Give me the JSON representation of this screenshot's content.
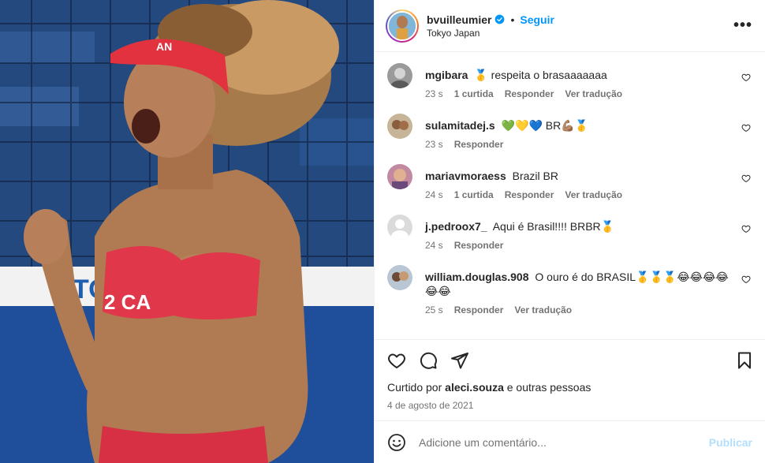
{
  "post": {
    "photo_alt": "Beach volleyball player celebrating",
    "jersey_text": "2 CA",
    "banner_text": "TO",
    "visor_text": "AN"
  },
  "header": {
    "username": "bvuilleumier",
    "follow_label": "Seguir",
    "location": "Tokyo Japan",
    "more_label": "•••"
  },
  "comments": [
    {
      "user": "mgibara",
      "text": "🥇 respeita o brasaaaaaaa",
      "time": "23 s",
      "likes": "1 curtida",
      "reply": "Responder",
      "translate": "Ver tradução"
    },
    {
      "user": "sulamitadej.s",
      "text": "💚💛💙 BR💪🏽🥇",
      "time": "23 s",
      "likes": "",
      "reply": "Responder",
      "translate": ""
    },
    {
      "user": "mariavmoraess",
      "text": "Brazil BR",
      "time": "24 s",
      "likes": "1 curtida",
      "reply": "Responder",
      "translate": "Ver tradução"
    },
    {
      "user": "j.pedroox7_",
      "text": "Aqui é Brasil!!!! BRBR🥇",
      "time": "24 s",
      "likes": "",
      "reply": "Responder",
      "translate": ""
    },
    {
      "user": "william.douglas.908",
      "text": "O ouro é do BRASIL🥇🥇🥇😂😂😂😂😂😂",
      "time": "25 s",
      "likes": "",
      "reply": "Responder",
      "translate": "Ver tradução"
    }
  ],
  "footer": {
    "liked_prefix": "Curtido por",
    "liked_user": "aleci.souza",
    "liked_suffix": "e outras pessoas",
    "date": "4 de agosto de 2021",
    "comment_placeholder": "Adicione um comentário...",
    "publish_label": "Publicar"
  },
  "colors": {
    "accent": "#0095f6",
    "publish_disabled": "#b2dffc",
    "muted": "#737373"
  }
}
